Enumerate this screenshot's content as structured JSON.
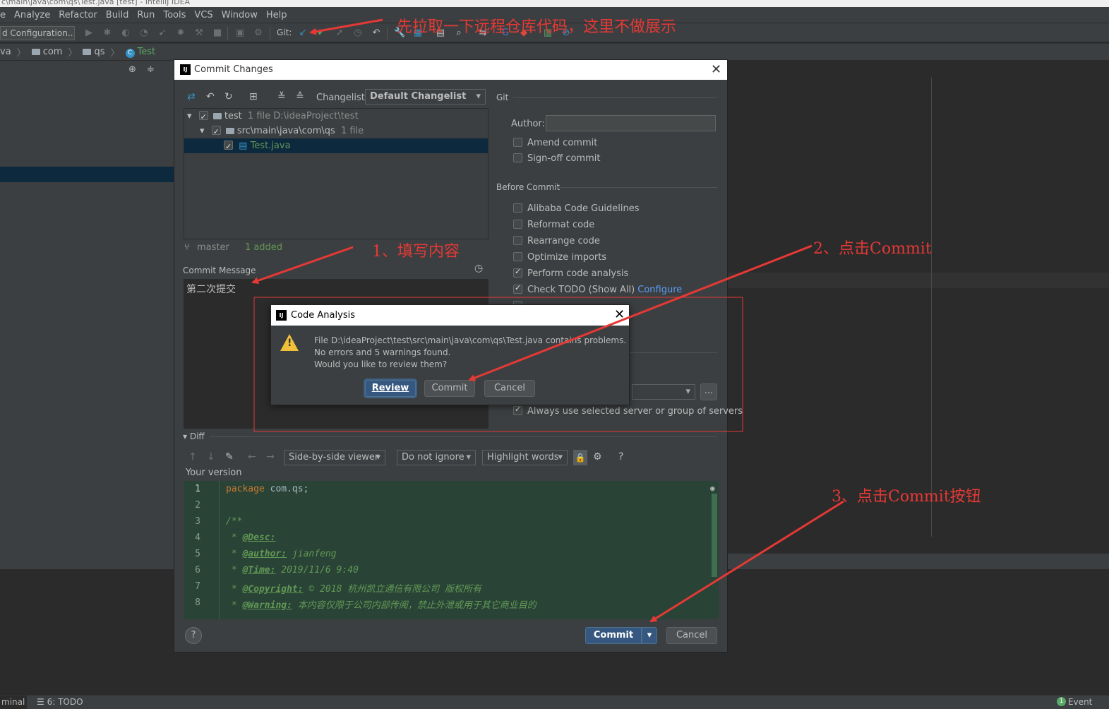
{
  "window": {
    "title_fragment": "c\\main\\java\\com\\qs\\Test.java [test] - IntelliJ IDEA"
  },
  "menu": [
    "e",
    "Analyze",
    "Refactor",
    "Build",
    "Run",
    "Tools",
    "VCS",
    "Window",
    "Help"
  ],
  "toolbar": {
    "run_config": "d Configuration...",
    "git_label": "Git:"
  },
  "breadcrumb": {
    "items": [
      "va",
      "com",
      "qs"
    ],
    "current": "Test",
    "current_icon": "C"
  },
  "commit_dialog": {
    "title": "Commit Changes",
    "changelist_label": "Changelist:",
    "changelist_value": "Default Changelist",
    "tree": {
      "root_name": "test",
      "root_meta": "1 file  D:\\ideaProject\\test",
      "dir_name": "src\\main\\java\\com\\qs",
      "dir_meta": "1 file",
      "file_name": "Test.java"
    },
    "branch": "master",
    "branch_status": "1 added",
    "commit_message_label": "Commit Message",
    "commit_message": "第二次提交",
    "git_section": "Git",
    "author_label": "Author:",
    "author_value": "",
    "amend_commit": "Amend commit",
    "signoff_commit": "Sign-off commit",
    "before_commit_section": "Before Commit",
    "before_commit_options": [
      {
        "label": "Alibaba Code Guidelines",
        "checked": false
      },
      {
        "label": "Reformat code",
        "checked": false
      },
      {
        "label": "Rearrange code",
        "checked": false
      },
      {
        "label": "Optimize imports",
        "checked": false
      },
      {
        "label": "Perform code analysis",
        "checked": true
      },
      {
        "label": "Check TODO (Show All)",
        "checked": true
      }
    ],
    "configure_link": "Configure",
    "server_browse": "...",
    "always_use_server": "Always use selected server or group of servers",
    "diff_label": "Diff",
    "viewer_mode": "Side-by-side viewer",
    "ignore_mode": "Do not ignore",
    "highlight_mode": "Highlight words",
    "help_label": "?",
    "your_version": "Your version",
    "code_lines": [
      {
        "n": "1",
        "text": "package com.qs;"
      },
      {
        "n": "2",
        "text": ""
      },
      {
        "n": "3",
        "text": "/**"
      },
      {
        "n": "4",
        "tag": "@Desc:",
        "rest": ""
      },
      {
        "n": "5",
        "tag": "@author:",
        "rest": " jianfeng"
      },
      {
        "n": "6",
        "tag": "@Time:",
        "rest": " 2019/11/6 9:40"
      },
      {
        "n": "7",
        "tag": "@Copyright:",
        "rest": " © 2018 杭州凯立通信有限公司 版权所有"
      },
      {
        "n": "8",
        "tag": "@Warning:",
        "rest": " 本内容仅限于公司内部传阅，禁止外泄或用于其它商业目的"
      }
    ],
    "commit_button": "Commit",
    "cancel_button": "Cancel"
  },
  "code_analysis_dialog": {
    "title": "Code Analysis",
    "message_line1": "File D:\\ideaProject\\test\\src\\main\\java\\com\\qs\\Test.java contains problems.",
    "message_line2": "No errors and 5 warnings found.",
    "message_line3": "Would you like to review them?",
    "review_button": "Review",
    "commit_button": "Commit",
    "cancel_button": "Cancel"
  },
  "status_bar": {
    "terminal": "minal",
    "todo": "6: TODO",
    "event_count": "1",
    "event_log": "Event Log"
  },
  "annotations": {
    "top": "先拉取一下远程仓库代码，这里不做展示",
    "step1": "1、填写内容",
    "step2": "2、点击Commit",
    "step3": "3、点击Commit按钮"
  },
  "colors": {
    "annotation_red": "#e53935",
    "primary_button": "#365880",
    "diff_background": "#294436"
  }
}
